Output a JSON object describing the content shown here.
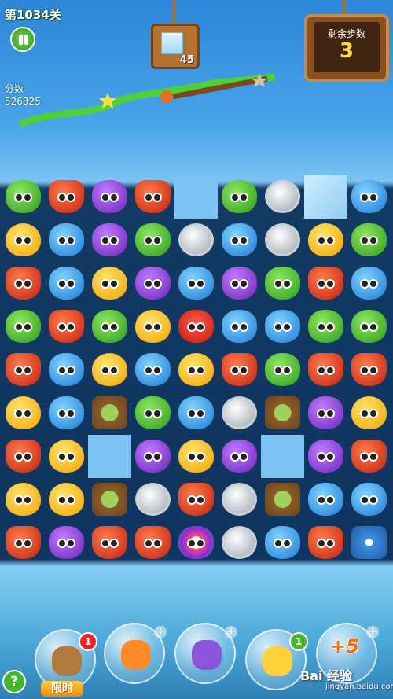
{
  "hud": {
    "level": "第1034关",
    "score_label": "分数",
    "score_value": "526325",
    "target_count": "45",
    "moves_label": "剩余步数",
    "moves_value": "3"
  },
  "board": {
    "rows": [
      [
        "frog",
        "fox",
        "owl",
        "fox",
        "hole",
        "frog",
        "coin",
        "ice",
        "blue"
      ],
      [
        "chick",
        "blue",
        "owl",
        "frog",
        "coin",
        "blue",
        "coin",
        "chick",
        "frog"
      ],
      [
        "fox",
        "blue",
        "chick",
        "owl",
        "blue",
        "owl",
        "frog",
        "fox",
        "blue"
      ],
      [
        "frog",
        "fox",
        "frog",
        "chick",
        "mon",
        "blue",
        "blue",
        "frog",
        "frog"
      ],
      [
        "fox",
        "blue",
        "chick",
        "blue",
        "chick",
        "fox",
        "frog",
        "fox",
        "fox"
      ],
      [
        "chick",
        "blue",
        "leaf",
        "frog",
        "blue",
        "coin",
        "leaf",
        "owl",
        "chick"
      ],
      [
        "fox",
        "chick",
        "hole",
        "owl",
        "chick",
        "owl",
        "hole",
        "owl",
        "fox"
      ],
      [
        "chick",
        "chick",
        "leaf",
        "coin",
        "fox",
        "coin",
        "leaf",
        "blue",
        "blue"
      ],
      [
        "fox",
        "owl",
        "fox",
        "fox",
        "bird",
        "coin",
        "blue",
        "fox",
        "flower"
      ]
    ]
  },
  "boosters": [
    {
      "name": "hammer",
      "badge": "1",
      "label": "限时"
    },
    {
      "name": "clock",
      "badge": "+"
    },
    {
      "name": "swap",
      "badge": "+"
    },
    {
      "name": "wand",
      "badge": "1"
    },
    {
      "name": "plus5",
      "text": "+5",
      "badge": "+"
    }
  ],
  "help": "?",
  "watermark": "Bai 经验",
  "watermark_sub": "jingyan.baidu.com",
  "colors": {
    "board_bg": "#123a63",
    "accent": "#ffd93a"
  }
}
